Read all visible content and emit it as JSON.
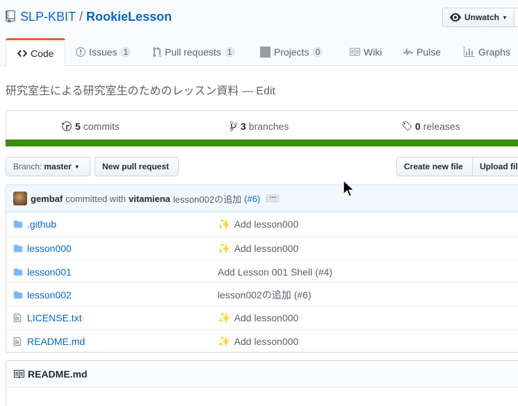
{
  "repo": {
    "owner": "SLP-KBIT",
    "separator": "/",
    "name": "RookieLesson"
  },
  "watch": {
    "label": "Unwatch"
  },
  "tabs": [
    {
      "label": "Code"
    },
    {
      "label": "Issues",
      "count": "1"
    },
    {
      "label": "Pull requests",
      "count": "1"
    },
    {
      "label": "Projects",
      "count": "0"
    },
    {
      "label": "Wiki"
    },
    {
      "label": "Pulse"
    },
    {
      "label": "Graphs"
    }
  ],
  "description": "研究室生による研究室生のためのレッスン資料 — Edit",
  "summary": {
    "commits": {
      "count": "5",
      "label": "commits"
    },
    "branches": {
      "count": "3",
      "label": "branches"
    },
    "releases": {
      "count": "0",
      "label": "releases"
    }
  },
  "toolbar": {
    "branch_prefix": "Branch:",
    "branch_name": "master",
    "new_pr": "New pull request",
    "create_file": "Create new file",
    "upload_files": "Upload files"
  },
  "commit": {
    "author": "gembaf",
    "committed_with": "committed with",
    "committer": "vitamiena",
    "message": "lesson002の追加",
    "pr_link": "(#6)",
    "ellipsis": "…"
  },
  "files": [
    {
      "name": ".github",
      "type": "dir",
      "sparkle": true,
      "message": "Add lesson000"
    },
    {
      "name": "lesson000",
      "type": "dir",
      "sparkle": true,
      "message": "Add lesson000"
    },
    {
      "name": "lesson001",
      "type": "dir",
      "sparkle": false,
      "message": "Add Lesson 001 Shell (#4)"
    },
    {
      "name": "lesson002",
      "type": "dir",
      "sparkle": false,
      "message": "lesson002の追加 (#6)"
    },
    {
      "name": "LICENSE.txt",
      "type": "file",
      "sparkle": true,
      "message": "Add lesson000"
    },
    {
      "name": "README.md",
      "type": "file",
      "sparkle": true,
      "message": "Add lesson000"
    }
  ],
  "readme": {
    "title": "README.md"
  },
  "colors": {
    "accent": "#0366d6",
    "tab_highlight": "#e36209",
    "language_bar": "#3c8c12",
    "folder": "#79b8ff"
  }
}
